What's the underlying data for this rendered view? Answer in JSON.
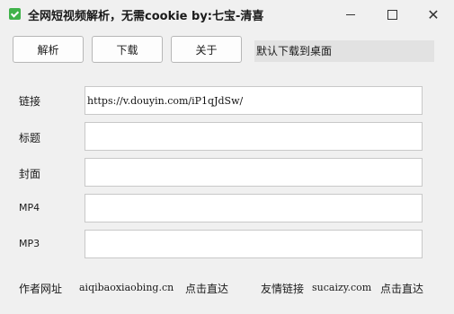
{
  "window": {
    "title": "全网短视频解析，无需cookie  by:七宝-清喜",
    "close_glyph": "✕"
  },
  "toolbar": {
    "parse_label": "解析",
    "download_label": "下载",
    "about_label": "关于",
    "status_text": "默认下载到桌面"
  },
  "form": {
    "link": {
      "label": "链接",
      "value": "https://v.douyin.com/iP1qJdSw/"
    },
    "title": {
      "label": "标题",
      "value": ""
    },
    "cover": {
      "label": "封面",
      "value": ""
    },
    "mp4": {
      "label": "MP4",
      "value": ""
    },
    "mp3": {
      "label": "MP3",
      "value": ""
    }
  },
  "footer": {
    "author_label": "作者网址",
    "author_site": "aiqibaoxiaobing.cn",
    "author_go": "点击直达",
    "friend_label": "友情链接",
    "friend_site": "sucaizy.com",
    "friend_go": "点击直达"
  }
}
